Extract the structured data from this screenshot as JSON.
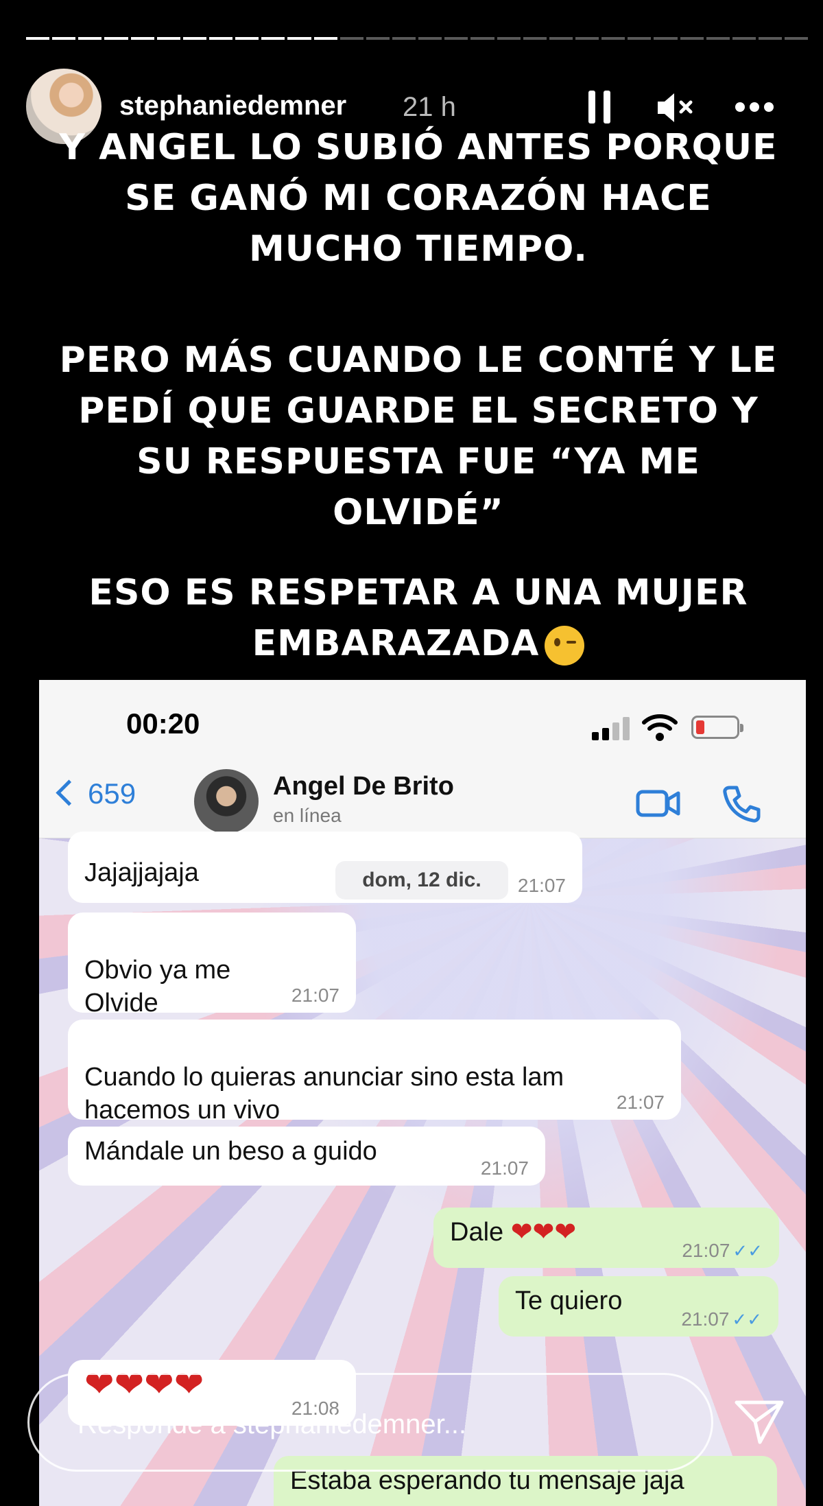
{
  "story": {
    "progress_segments": 30,
    "progress_done": 12,
    "username": "stephaniedemner",
    "time": "21 h",
    "caption": [
      "Y ANGEL LO SUBIÓ ANTES PORQUE\nSE GANÓ MI CORAZÓN HACE\nMUCHO TIEMPO.",
      "PERO MÁS CUANDO LE CONTÉ Y LE\nPEDÍ QUE GUARDE EL SECRETO Y\nSU RESPUESTA FUE “YA ME\nOLVIDÉ”",
      "ESO ES RESPETAR A UNA MUJER\nEMBARAZADA"
    ],
    "reply_placeholder": "Responde a stephaniedemner..."
  },
  "whatsapp": {
    "clock": "00:20",
    "back_count": "659",
    "contact_name": "Angel De Brito",
    "contact_status": "en línea",
    "date_chip": "dom, 12 dic.",
    "messages": [
      {
        "dir": "in",
        "text": "Jajajjajaja",
        "time": "21:07"
      },
      {
        "dir": "in",
        "text": "Obvio ya me\nOlvide",
        "time": "21:07"
      },
      {
        "dir": "in",
        "text": "Cuando lo quieras anunciar sino esta lam\nhacemos un vivo",
        "time": "21:07"
      },
      {
        "dir": "in",
        "text": "Mándale un beso a guido",
        "time": "21:07"
      },
      {
        "dir": "out",
        "text": "Dale",
        "hearts": "❤❤❤",
        "time": "21:07"
      },
      {
        "dir": "out",
        "text": "Te quiero",
        "time": "21:07"
      },
      {
        "dir": "in",
        "text": "",
        "hearts": "❤❤❤❤",
        "time": "21:08"
      },
      {
        "dir": "out",
        "text": "Estaba esperando tu mensaje jaja",
        "time": ""
      }
    ]
  },
  "colors": {
    "whatsapp_blue": "#2e7fd8",
    "outgoing_bubble": "#dcf5c8",
    "heart_red": "#d32222"
  },
  "icons": [
    "pause-icon",
    "mute-icon",
    "more-icon",
    "send-icon",
    "video-call-icon",
    "phone-icon",
    "back-chevron-icon",
    "wink-emoji-icon"
  ]
}
